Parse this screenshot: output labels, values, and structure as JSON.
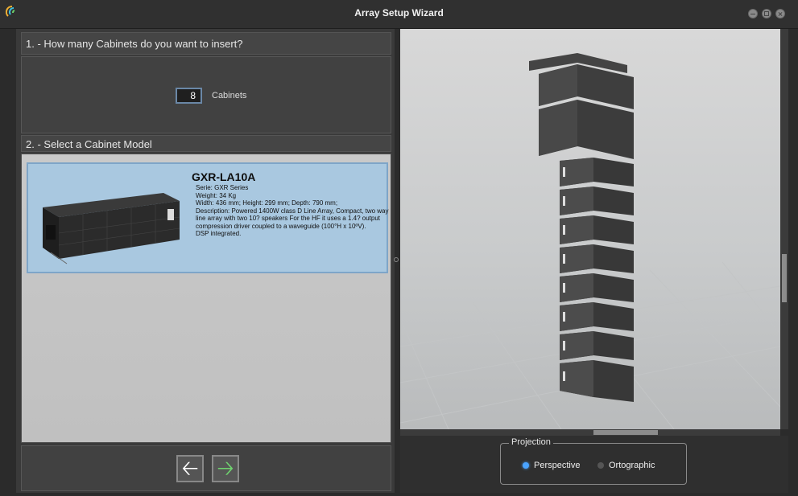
{
  "window": {
    "title": "Array Setup Wizard"
  },
  "step1": {
    "label": "1. -  How many Cabinets do you want to insert?",
    "cabinets_value": "8",
    "cabinets_unit": "Cabinets"
  },
  "step2": {
    "label": "2. -  Select a Cabinet Model",
    "models": [
      {
        "name": "GXR-LA10A",
        "serie": "Serie: GXR Series",
        "weight": "Weight: 34 Kg",
        "dimensions": "Width: 436 mm; Height: 299 mm; Depth: 790 mm;",
        "description": "Description: Powered 1400W class D Line Array, Compact, two way line array with two 10? speakers For the HF it uses a 1.4? output compression driver coupled to a waveguide (100°H x 10ºV).",
        "dsp": "DSP integrated.",
        "selected": true
      }
    ]
  },
  "nav": {
    "back_icon": "arrow-left-icon",
    "next_icon": "arrow-right-icon"
  },
  "projection": {
    "legend": "Projection",
    "options": [
      {
        "label": "Perspective",
        "checked": true
      },
      {
        "label": "Ortographic",
        "checked": false
      }
    ]
  },
  "viewport": {
    "cabinet_count": 8
  },
  "colors": {
    "accent": "#4aa3ff",
    "selection": "#a9c8e0",
    "next_arrow": "#6fd36f"
  }
}
